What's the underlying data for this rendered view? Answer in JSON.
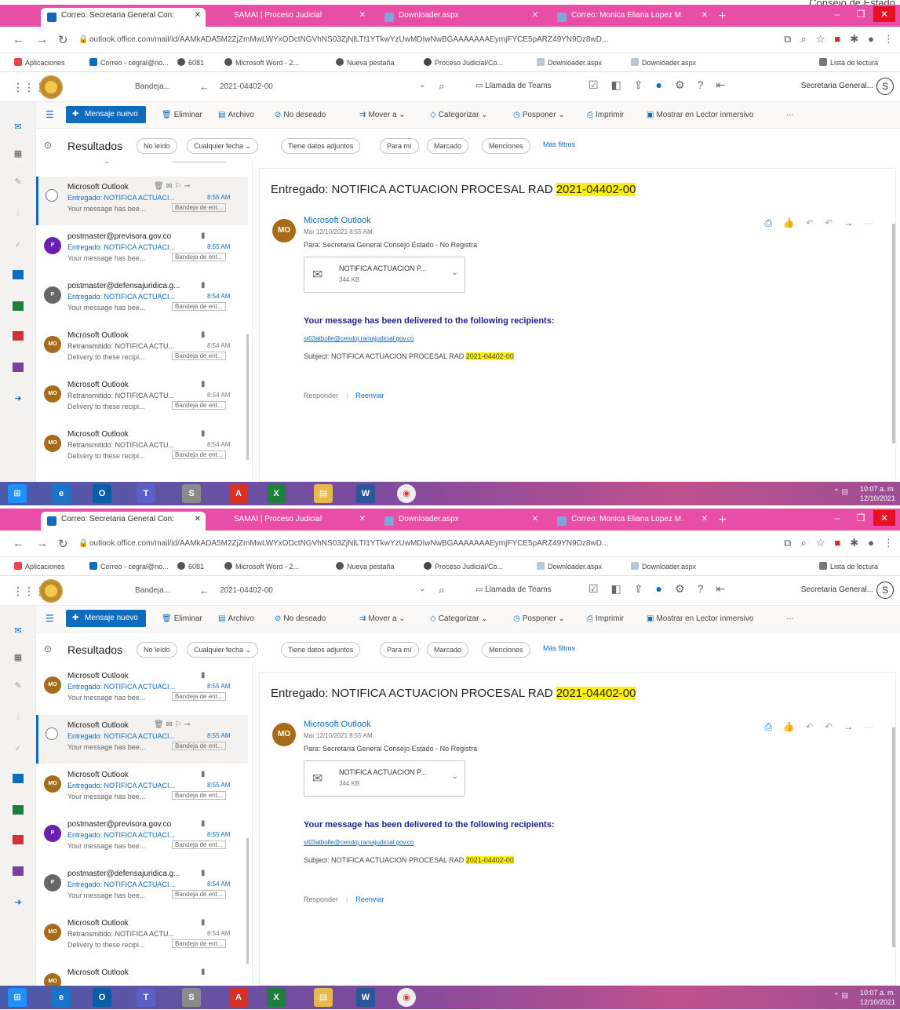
{
  "doc_header": "Consejo de Estado",
  "browser": {
    "tabs": [
      {
        "label": "Correo: Secretaria General Con:",
        "active": true,
        "close": "✕"
      },
      {
        "label": "SAMAI | Proceso Judicial",
        "active": false,
        "close": "✕"
      },
      {
        "label": "Downloader.aspx",
        "active": false,
        "close": "✕"
      },
      {
        "label": "Correo: Monica Eliana Lopez M.",
        "active": false,
        "close": "✕"
      }
    ],
    "new_tab": "+",
    "url": "outlook.office.com/mail/id/AAMkADA5M2ZjZmMwLWYxODctNGVhNS03ZjNlLTI1YTkwYzUwMDIwNwBGAAAAAAAEymjFYCE5pARZ49YN9Dz8wD...",
    "bookmarks": [
      "Aplicaciones",
      "Correo - cegral@no...",
      "6081",
      "Microsoft Word - 2...",
      "Nueva pestaña",
      "Proceso Judicial/Co...",
      "Downloader.aspx",
      "Downloader.aspx"
    ],
    "reading_list": "Lista de lectura"
  },
  "outlook": {
    "search_scope": "Bandeja...",
    "search_query": "2021-04402-00",
    "teams_call": "Llamada de Teams",
    "user_name": "Secretaria General...",
    "user_initial": "S",
    "new_message": "Mensaje nuevo",
    "commands": [
      "Eliminar",
      "Archivo",
      "No deseado",
      "Mover a",
      "Categorizar",
      "Posponer",
      "Imprimir",
      "Mostrar en Lector inmersivo",
      "···"
    ],
    "results_title": "Resultados",
    "filters": [
      "No leído",
      "Cualquier fecha",
      "Tiene datos adjuntos",
      "Para mí",
      "Marcado",
      "Menciones"
    ],
    "more_filters": "Más filtros"
  },
  "shot1_messages": [
    {
      "partial": true,
      "from": "",
      "subject": "",
      "time": "",
      "preview": "Your message has bee...",
      "tag": "Bandeja de ent...",
      "avatar": "",
      "color": ""
    },
    {
      "selected": true,
      "from": "Microsoft Outlook",
      "subject": "Entregado: NOTIFICA ACTUACI...",
      "time": "8:55 AM",
      "preview": "Your message has bee...",
      "tag": "Bandeja de ent...",
      "avatar": "",
      "color": ""
    },
    {
      "from": "postmaster@previsora.gov.co",
      "subject": "Entregado: NOTIFICA ACTUACI...",
      "time": "8:55 AM",
      "preview": "Your message has bee...",
      "tag": "Bandeja de ent...",
      "avatar": "P",
      "color": "#6b1fb1"
    },
    {
      "from": "postmaster@defensajuridica.g...",
      "subject": "Entregado: NOTIFICA ACTUACI...",
      "time": "8:54 AM",
      "preview": "Your message has bee...",
      "tag": "Bandeja de ent...",
      "avatar": "P",
      "color": "#666666"
    },
    {
      "from": "Microsoft Outlook",
      "subject": "Retransmitido: NOTIFICA ACTU...",
      "time": "8:54 AM",
      "preview": "Delivery to these recipi...",
      "tag": "Bandeja de ent...",
      "avatar": "MO",
      "color": "#a66c1a"
    },
    {
      "from": "Microsoft Outlook",
      "subject": "Retransmitido: NOTIFICA ACTU...",
      "time": "8:54 AM",
      "preview": "Delivery to these recipi...",
      "tag": "Bandeja de ent...",
      "avatar": "MO",
      "color": "#a66c1a"
    },
    {
      "from": "Microsoft Outlook",
      "subject": "Retransmitido: NOTIFICA ACTU...",
      "time": "8:54 AM",
      "preview": "Delivery to these recipi...",
      "tag": "Bandeja de ent...",
      "avatar": "MO",
      "color": "#a66c1a"
    }
  ],
  "shot2_messages": [
    {
      "from": "Microsoft Outlook",
      "subject": "Entregado: NOTIFICA ACTUACI...",
      "time": "8:55 AM",
      "preview": "Your message has bee...",
      "tag": "Bandeja de ent...",
      "avatar": "MO",
      "color": "#a66c1a"
    },
    {
      "selected": true,
      "from": "Microsoft Outlook",
      "subject": "Entregado: NOTIFICA ACTUACI...",
      "time": "8:55 AM",
      "preview": "Your message has bee...",
      "tag": "Bandeja de ent...",
      "avatar": "",
      "color": ""
    },
    {
      "from": "Microsoft Outlook",
      "subject": "Entregado: NOTIFICA ACTUACI...",
      "time": "8:55 AM",
      "preview": "Your message has bee...",
      "tag": "Bandeja de ent...",
      "avatar": "MO",
      "color": "#a66c1a"
    },
    {
      "from": "postmaster@previsora.gov.co",
      "subject": "Entregado: NOTIFICA ACTUACI...",
      "time": "8:55 AM",
      "preview": "Your message has bee...",
      "tag": "Bandeja de ent...",
      "avatar": "P",
      "color": "#6b1fb1"
    },
    {
      "from": "postmaster@defensajuridica.g...",
      "subject": "Entregado: NOTIFICA ACTUACI...",
      "time": "8:54 AM",
      "preview": "Your message has bee...",
      "tag": "Bandeja de ent...",
      "avatar": "P",
      "color": "#666666"
    },
    {
      "from": "Microsoft Outlook",
      "subject": "Retransmitido: NOTIFICA ACTU...",
      "time": "8:54 AM",
      "preview": "Delivery to these recipi...",
      "tag": "Bandeja de ent...",
      "avatar": "MO",
      "color": "#a66c1a"
    },
    {
      "from": "Microsoft Outlook",
      "subject": "",
      "time": "",
      "preview": "",
      "tag": "",
      "avatar": "MO",
      "color": "#a66c1a"
    }
  ],
  "reading": {
    "subject_prefix": "Entregado: NOTIFICA ACTUACION PROCESAL RAD ",
    "subject_highlight": "2021-04402-00",
    "sender": "Microsoft Outlook",
    "sender_initials": "MO",
    "date": "Mar 12/10/2021 8:55 AM",
    "to": "Para: Secretaria General Consejo Estado - No Registra",
    "attachment_name": "NOTIFICA ACTUACION P...",
    "attachment_size": "344 KB",
    "body_heading": "Your message has been delivered to the following recipients:",
    "recipient_link": "st03atbolle@cendoj.ramajudicial.gov.co",
    "body_subject_prefix": "Subject: NOTIFICA ACTUACION PROCESAL RAD ",
    "body_subject_highlight": "2021-04402-00",
    "reply": "Responder",
    "forward": "Reenviar"
  },
  "taskbar": {
    "time": "10:07 a. m.",
    "date": "12/10/2021"
  },
  "colors": {
    "accent": "#0f6cbd",
    "tabstrip": "#e94ea6",
    "highlight": "#fff200"
  }
}
